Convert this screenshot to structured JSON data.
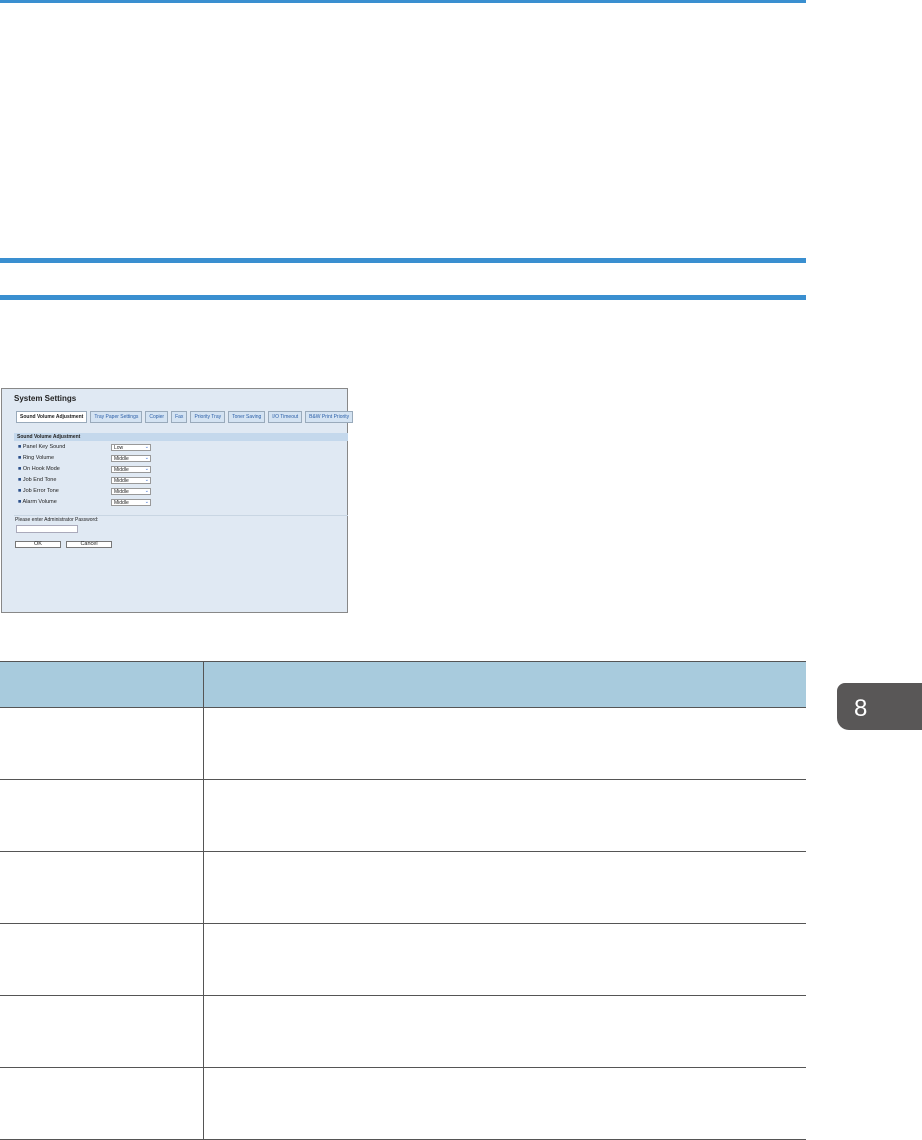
{
  "chapter_tab": "8",
  "screenshot": {
    "title": "System Settings",
    "tabs": [
      "Sound Volume Adjustment",
      "Tray Paper Settings",
      "Copier",
      "Fax",
      "Priority Tray",
      "Toner Saving",
      "I/O Timeout",
      "B&W Print Priority"
    ],
    "section_header": "Sound Volume Adjustment",
    "settings": [
      {
        "label": "Panel Key Sound",
        "value": "Low"
      },
      {
        "label": "Ring Volume",
        "value": "Middle"
      },
      {
        "label": "On Hook Mode",
        "value": "Middle"
      },
      {
        "label": "Job End Tone",
        "value": "Middle"
      },
      {
        "label": "Job Error Tone",
        "value": "Middle"
      },
      {
        "label": "Alarm Volume",
        "value": "Middle"
      }
    ],
    "password_label": "Please enter Administrator Password:",
    "password_value": "",
    "ok_label": "OK",
    "cancel_label": "Cancel"
  }
}
